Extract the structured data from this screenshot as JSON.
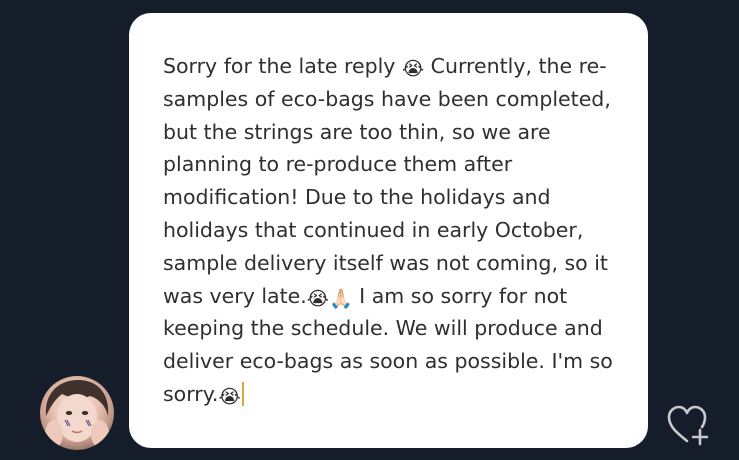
{
  "message": {
    "seg1": "Sorry for the late reply ",
    "emoji1": "😭",
    "seg2": " Currently, the re-samples of eco-bags have been completed, but the strings are too thin, so we are planning to re-produce them after modification! Due to the holidays and holidays that continued in early October, sample delivery itself was not coming, so it was very late.",
    "emoji2": "😭",
    "emoji3": "🙏🏻",
    "seg3": " I am so sorry for not keeping the schedule. We will produce and deliver eco-bags as soon as possible. I'm so sorry.",
    "emoji4": "😭"
  },
  "icons": {
    "avatar": "profile-photo",
    "reaction": "heart-plus-icon"
  },
  "colors": {
    "background": "#151d2b",
    "bubble": "#ffffff",
    "text": "#2f2f2f",
    "caret": "#e5a13b",
    "icon": "#c9c9cc"
  }
}
